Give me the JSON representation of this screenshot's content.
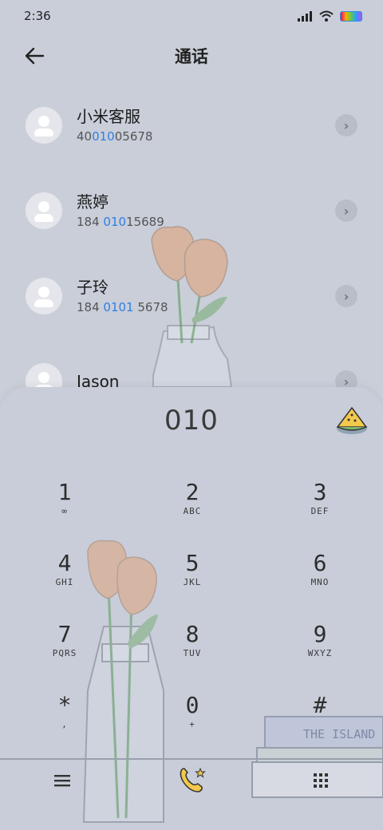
{
  "status_bar": {
    "time": "2:36"
  },
  "header": {
    "title": "通话"
  },
  "contacts": [
    {
      "name": "小米客服",
      "number_parts": [
        "40",
        "010",
        "05678"
      ]
    },
    {
      "name": "燕婷",
      "number_parts": [
        "184 ",
        "010",
        "15689"
      ]
    },
    {
      "name": "子玲",
      "number_parts": [
        "184 ",
        "0101",
        " 5678"
      ]
    },
    {
      "name": "Jason",
      "number_parts": [
        "",
        "",
        ""
      ]
    }
  ],
  "dialpad": {
    "display": "010",
    "keys": [
      {
        "digit": "1",
        "letters": "∞"
      },
      {
        "digit": "2",
        "letters": "ABC"
      },
      {
        "digit": "3",
        "letters": "DEF"
      },
      {
        "digit": "4",
        "letters": "GHI"
      },
      {
        "digit": "5",
        "letters": "JKL"
      },
      {
        "digit": "6",
        "letters": "MNO"
      },
      {
        "digit": "7",
        "letters": "PQRS"
      },
      {
        "digit": "8",
        "letters": "TUV"
      },
      {
        "digit": "9",
        "letters": "WXYZ"
      },
      {
        "digit": "*",
        "letters": ","
      },
      {
        "digit": "0",
        "letters": "+"
      },
      {
        "digit": "#",
        "letters": ""
      }
    ]
  },
  "decoration": {
    "book_title": "THE ISLAND"
  },
  "colors": {
    "background": "#c9ced9",
    "highlight": "#2f7fe0",
    "call_button": "#f2c94c"
  }
}
